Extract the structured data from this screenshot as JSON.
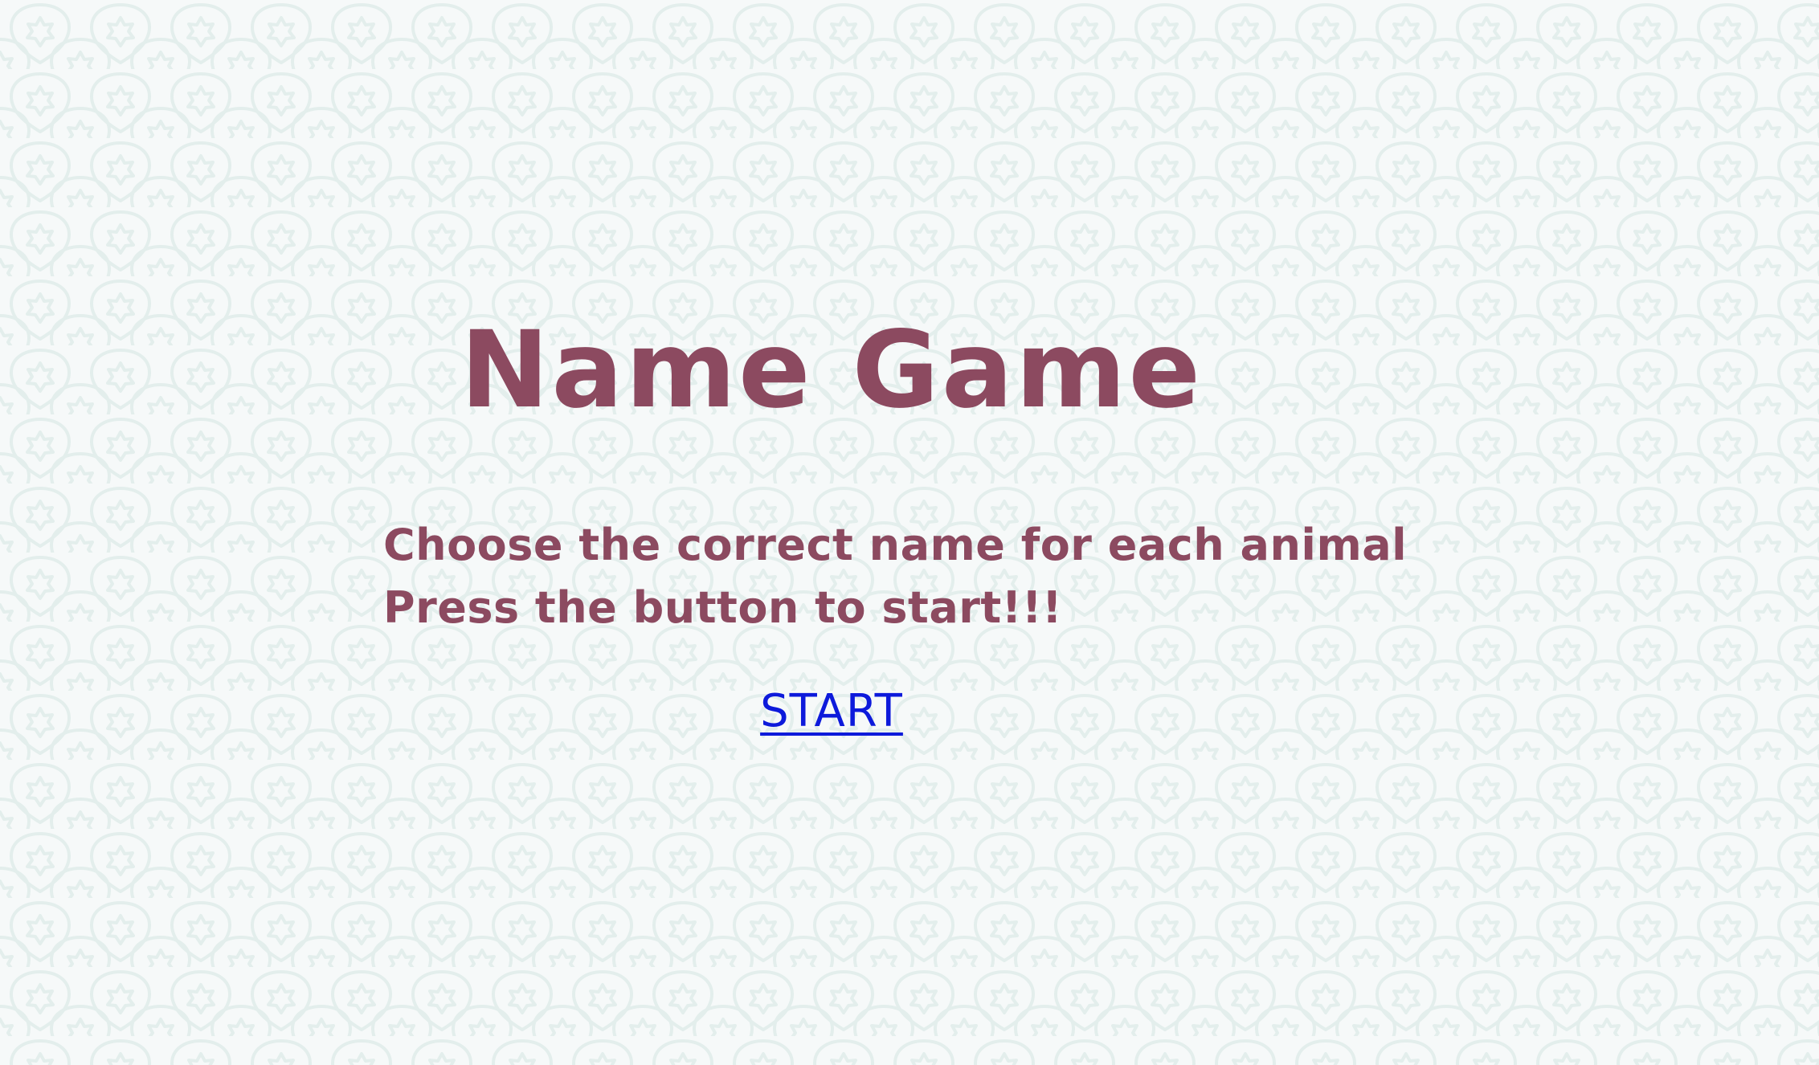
{
  "page": {
    "title": "Name Game",
    "instructions": [
      "Choose the correct name for each animal",
      "Press the button to start!!!"
    ],
    "start_link_label": "START"
  },
  "theme": {
    "background": "#f6f9f9",
    "pattern_color": "#e3eeec",
    "text_color": "#8c4a60",
    "link_color": "#0d1adb"
  },
  "icons": {
    "background_pattern": "floral-tile-pattern"
  }
}
